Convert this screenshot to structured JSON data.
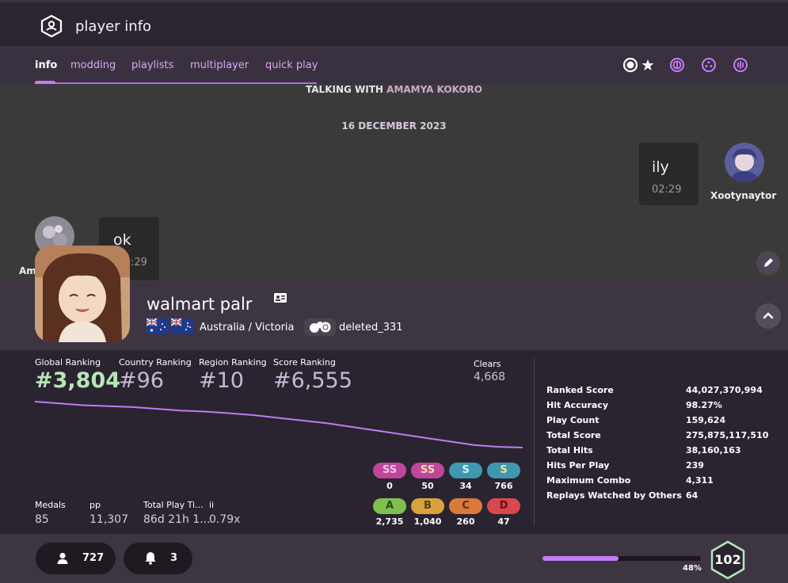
{
  "app": {
    "title": "player info"
  },
  "nav": {
    "tabs": [
      {
        "label": "info",
        "active": true
      },
      {
        "label": "modding"
      },
      {
        "label": "playlists"
      },
      {
        "label": "multiplayer"
      },
      {
        "label": "quick play"
      }
    ],
    "icons": [
      "osu-mode-icon",
      "star-icon",
      "taiko-icon",
      "catch-icon",
      "mania-icon"
    ]
  },
  "chat": {
    "header_prefix": "TALKING WITH",
    "header_name": "AMAMYA KOKORO",
    "date": "16 DECEMBER 2023",
    "messages": [
      {
        "sender": "Xootynaytor",
        "text": "ily",
        "time": "02:29"
      },
      {
        "sender": "Am",
        "text": "ok",
        "time": ":29"
      }
    ]
  },
  "profile": {
    "username": "walmart palr",
    "location": "Australia / Victoria",
    "team": "deleted_331",
    "flags": [
      "Australia",
      "Australia"
    ]
  },
  "rankings": {
    "global": {
      "label": "Global Ranking",
      "value": "#3,804"
    },
    "country": {
      "label": "Country Ranking",
      "value": "#96"
    },
    "region": {
      "label": "Region Ranking",
      "value": "#10"
    },
    "score": {
      "label": "Score Ranking",
      "value": "#6,555"
    },
    "clears": {
      "label": "Clears",
      "value": "4,668"
    }
  },
  "rank_history": [
    3550,
    3560,
    3570,
    3575,
    3580,
    3590,
    3600,
    3605,
    3615,
    3625,
    3640,
    3655,
    3670,
    3690,
    3710,
    3730,
    3750,
    3770,
    3790,
    3800,
    3804
  ],
  "grades": [
    {
      "grade": "SS",
      "count": "0",
      "color": "#c0459c",
      "text": "#f0c6e4"
    },
    {
      "grade": "SS",
      "count": "50",
      "color": "#c0459c",
      "text": "#f5e1a4"
    },
    {
      "grade": "S",
      "count": "34",
      "color": "#3d98b0",
      "text": "#d9f1f7"
    },
    {
      "grade": "S",
      "count": "766",
      "color": "#3d98b0",
      "text": "#f5e1a4"
    },
    {
      "grade": "A",
      "count": "2,735",
      "color": "#7fbf4d",
      "text": "#2a4a1f"
    },
    {
      "grade": "B",
      "count": "1,040",
      "color": "#d9a23d",
      "text": "#5a3e12"
    },
    {
      "grade": "C",
      "count": "260",
      "color": "#d9793a",
      "text": "#5a2e12"
    },
    {
      "grade": "D",
      "count": "47",
      "color": "#d9484d",
      "text": "#5a1518"
    }
  ],
  "misc": [
    {
      "label": "Medals",
      "value": "85"
    },
    {
      "label": "pp",
      "value": "11,307"
    },
    {
      "label": "Total Play Ti...",
      "value": "86d 21h 1..."
    },
    {
      "label": "ii",
      "value": "0.79x"
    }
  ],
  "score_stats": [
    {
      "label": "Ranked Score",
      "value": "44,027,370,994"
    },
    {
      "label": "Hit Accuracy",
      "value": "98.27%"
    },
    {
      "label": "Play Count",
      "value": "159,624"
    },
    {
      "label": "Total Score",
      "value": "275,875,117,510"
    },
    {
      "label": "Total Hits",
      "value": "38,160,163"
    },
    {
      "label": "Hits Per Play",
      "value": "239"
    },
    {
      "label": "Maximum Combo",
      "value": "4,311"
    },
    {
      "label": "Replays Watched by Others",
      "value": "64"
    }
  ],
  "footer": {
    "friends": "727",
    "notifications": "3",
    "level": "102",
    "level_progress_label": "48%",
    "level_progress": 0.48
  },
  "colors": {
    "accent": "#c57bf6",
    "rank_green": "#b7e6b8",
    "level_ring": "#b7e6b8"
  }
}
